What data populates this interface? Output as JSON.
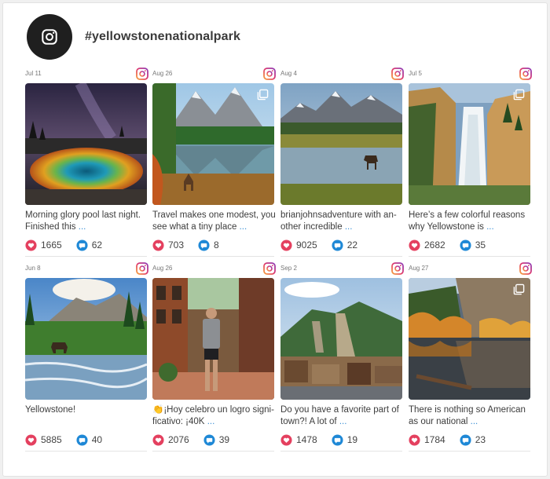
{
  "feed": {
    "hashtag": "#yellowstonenationalpark",
    "avatar_icon": "instagram-icon",
    "accent_like": "#e4405f",
    "accent_comment": "#1e88d6"
  },
  "posts": [
    {
      "date": "Jul 11",
      "caption": "Morning glory pool last night. Finished this",
      "more": "...",
      "likes": "1665",
      "comments": "62",
      "multi": false
    },
    {
      "date": "Aug 26",
      "caption": "Travel makes one modest, you see what a tiny place",
      "more": "...",
      "likes": "703",
      "comments": "8",
      "multi": true
    },
    {
      "date": "Aug 4",
      "caption": "brianjohnsadventure with an-other incredible",
      "more": "...",
      "likes": "9025",
      "comments": "22",
      "multi": false
    },
    {
      "date": "Jul 5",
      "caption": "Here’s a few colorful reasons why Yellowstone is",
      "more": "...",
      "likes": "2682",
      "comments": "35",
      "multi": true
    },
    {
      "date": "Jun 8",
      "caption": "Yellowstone!",
      "more": "",
      "likes": "5885",
      "comments": "40",
      "multi": false
    },
    {
      "date": "Aug 26",
      "caption": "👏¡Hoy celebro un logro signi-ficativo: ¡40K",
      "more": "...",
      "likes": "2076",
      "comments": "39",
      "multi": false
    },
    {
      "date": "Sep 2",
      "caption": "Do you have a favorite part of town?! A lot of",
      "more": "...",
      "likes": "1478",
      "comments": "19",
      "multi": false
    },
    {
      "date": "Aug 27",
      "caption": "There is nothing so American as our national",
      "more": "...",
      "likes": "1784",
      "comments": "23",
      "multi": true
    }
  ]
}
